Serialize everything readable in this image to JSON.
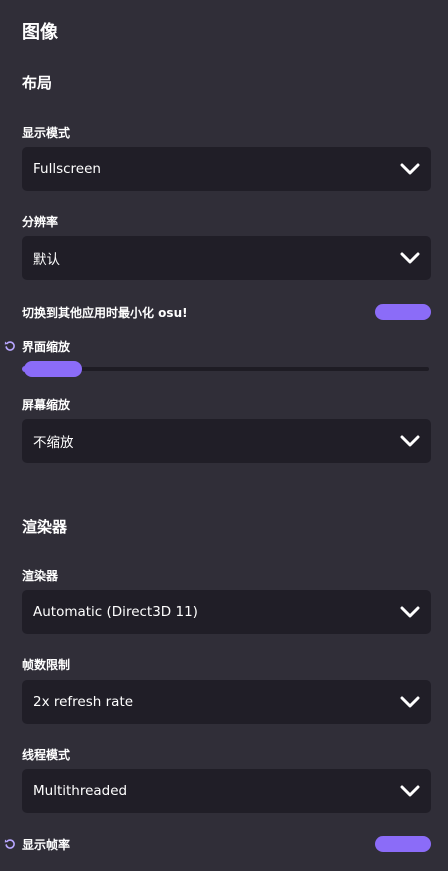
{
  "page_title": "图像",
  "sections": {
    "layout": {
      "title": "布局",
      "display_mode": {
        "label": "显示模式",
        "value": "Fullscreen"
      },
      "resolution": {
        "label": "分辨率",
        "value": "默认"
      },
      "minimize_toggle": {
        "label": "切换到其他应用时最小化 osu!",
        "enabled": true
      },
      "ui_scale": {
        "label": "界面缩放",
        "level": 0.08
      },
      "screen_scaling": {
        "label": "屏幕缩放",
        "value": "不缩放"
      }
    },
    "renderer": {
      "title": "渲染器",
      "renderer": {
        "label": "渲染器",
        "value": "Automatic (Direct3D 11)"
      },
      "frame_limiter": {
        "label": "帧数限制",
        "value": "2x refresh rate"
      },
      "threading_mode": {
        "label": "线程模式",
        "value": "Multithreaded"
      },
      "show_fps": {
        "label": "显示帧率",
        "enabled": true
      }
    }
  },
  "colors": {
    "accent": "#8b6cf8",
    "background": "#302e38",
    "field": "#201e27"
  }
}
